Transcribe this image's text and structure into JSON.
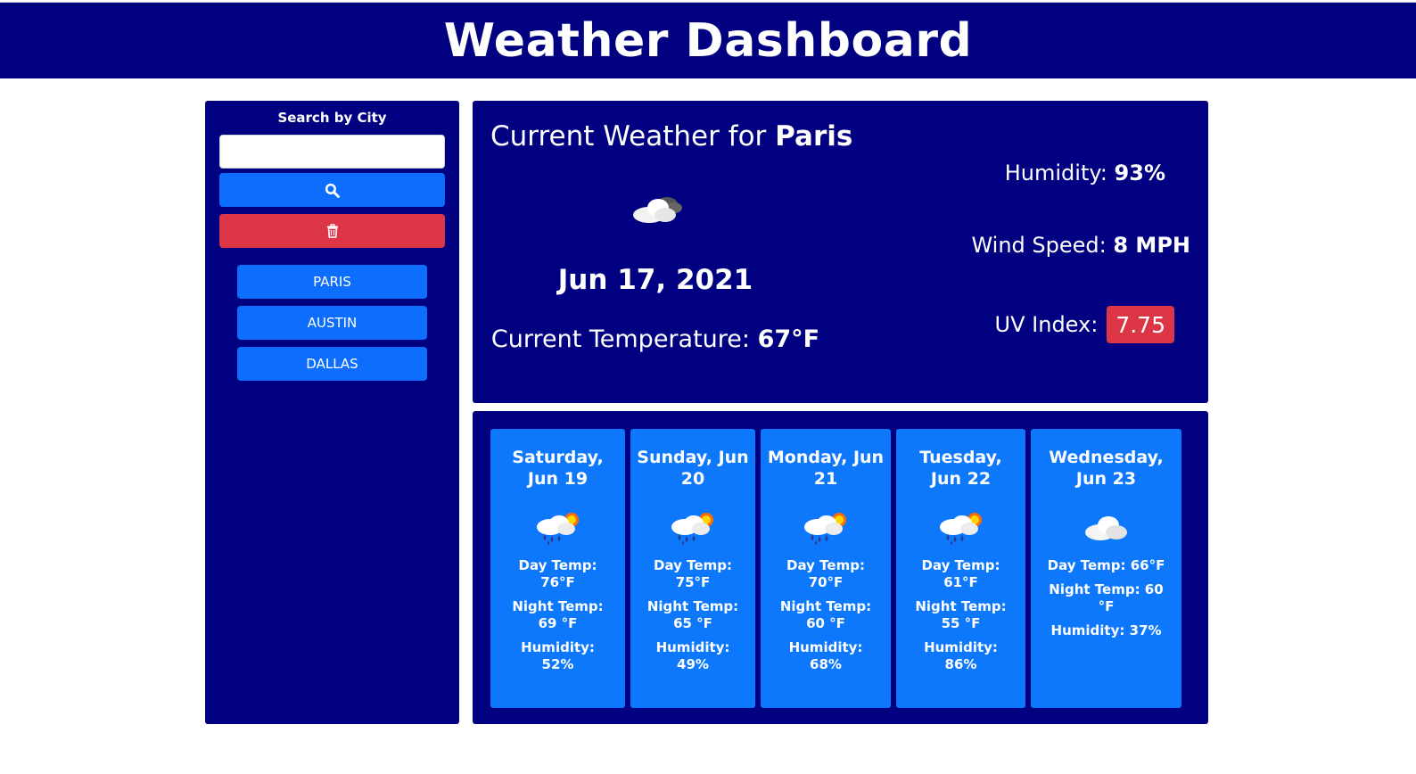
{
  "header": {
    "title": "Weather Dashboard"
  },
  "sidebar": {
    "search_label": "Search by City",
    "search_value": "",
    "search_button_icon": "search-icon",
    "clear_button_icon": "trash-icon",
    "cities": [
      "PARIS",
      "AUSTIN",
      "DALLAS"
    ]
  },
  "current": {
    "title_prefix": "Current Weather for",
    "city": "Paris",
    "icon": "cloudy-icon",
    "date": "Jun 17, 2021",
    "temp_label": "Current Temperature:",
    "temp_value": "67°F",
    "humidity_label": "Humidity:",
    "humidity_value": "93%",
    "wind_label": "Wind Speed:",
    "wind_value": "8 MPH",
    "uv_label": "UV Index:",
    "uv_value": "7.75",
    "uv_color": "#dc3545"
  },
  "forecast": [
    {
      "day": "Saturday, Jun 19",
      "icon": "rain-sun-icon",
      "day_temp": "Day Temp: 76°F",
      "night_temp": "Night Temp: 69 °F",
      "humidity": "Humidity: 52%"
    },
    {
      "day": "Sunday, Jun 20",
      "icon": "rain-sun-icon",
      "day_temp": "Day Temp: 75°F",
      "night_temp": "Night Temp: 65 °F",
      "humidity": "Humidity: 49%"
    },
    {
      "day": "Monday, Jun 21",
      "icon": "rain-sun-icon",
      "day_temp": "Day Temp: 70°F",
      "night_temp": "Night Temp: 60 °F",
      "humidity": "Humidity: 68%"
    },
    {
      "day": "Tuesday, Jun 22",
      "icon": "rain-sun-icon",
      "day_temp": "Day Temp: 61°F",
      "night_temp": "Night Temp: 55 °F",
      "humidity": "Humidity: 86%"
    },
    {
      "day": "Wednesday, Jun 23",
      "icon": "cloud-icon",
      "day_temp": "Day Temp: 66°F",
      "night_temp": "Night Temp: 60 °F",
      "humidity": "Humidity: 37%"
    }
  ],
  "colors": {
    "navy": "#000080",
    "primary": "#0d6efd",
    "danger": "#dc3545",
    "card": "#0d78fb"
  }
}
